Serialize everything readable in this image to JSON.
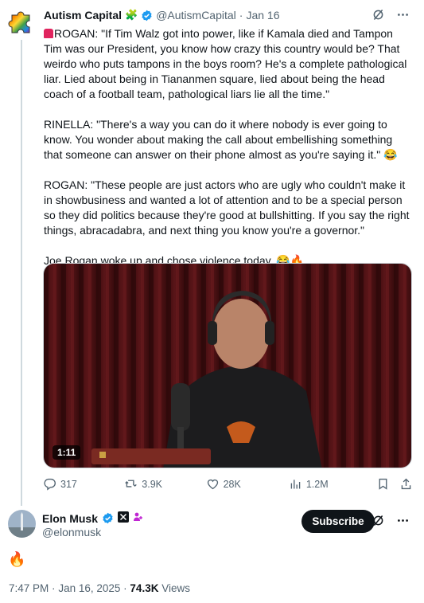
{
  "tweet": {
    "author_name": "Autism Capital",
    "author_emoji": "🧩",
    "handle": "@AutismCapital",
    "separator": "·",
    "date": "Jan 16",
    "paragraph_1": "ROGAN: \"If Tim Walz got into power, like if Kamala died and Tampon Tim was our President, you know how crazy this country would be? That weirdo who puts tampons in the boys room? He's a complete pathological liar. Lied about being in Tiananmen square, lied about being the head coach of a football team, pathological liars lie all the time.\"",
    "paragraph_2": "RINELLA: \"There's a way you can do it where nobody is ever going to know. You wonder about making the call about embellishing something that someone can answer on their phone almost as you're saying it.\"",
    "paragraph_2_emoji": "😂",
    "paragraph_3": "ROGAN: \"These people are just actors who are ugly who couldn't make it in showbusiness and wanted a lot of attention and to be a special person so they did politics because they're good at bullshitting. If you say the right things, abracadabra, and next thing you know you're a governor.\"",
    "paragraph_4": "Joe Rogan woke up and chose violence today.",
    "paragraph_4_emoji": "😂🔥",
    "video_duration": "1:11",
    "replies": "317",
    "reposts": "3.9K",
    "likes": "28K",
    "views": "1.2M"
  },
  "reply": {
    "author_name": "Elon Musk",
    "handle": "@elonmusk",
    "subscribe_label": "Subscribe",
    "body": "🔥",
    "time": "7:47 PM",
    "separator": "·",
    "date": "Jan 16, 2025",
    "separator2": "·",
    "views_count": "74.3K",
    "views_label": "Views"
  },
  "colors": {
    "text": "#0f1419",
    "muted": "#536471",
    "verified": "#1d9bf0",
    "divider": "#cfd9de",
    "subscribe_bg": "#0f1419"
  }
}
